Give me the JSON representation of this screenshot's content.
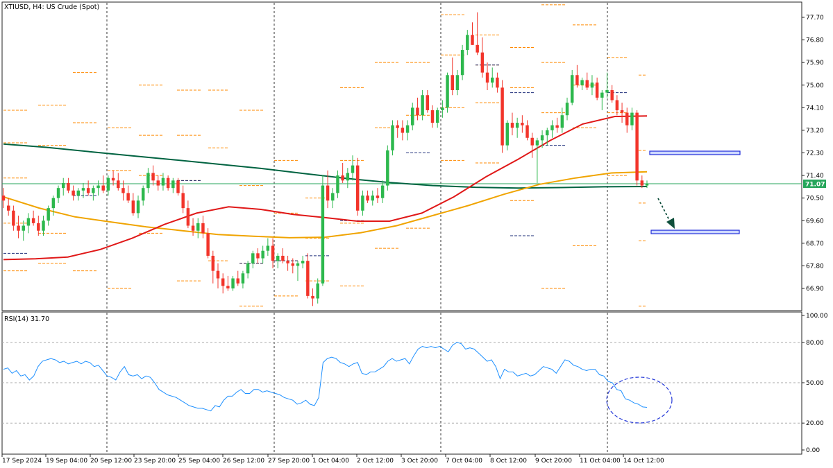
{
  "chart_data": [
    {
      "type": "line",
      "title": "XTIUSD, H4:  US Crude (Spot)",
      "symbol": "XTIUSD",
      "timeframe": "H4",
      "instrument_label": "US Crude (Spot)",
      "price_axis_ticks": [
        "77.70",
        "76.80",
        "75.90",
        "75.00",
        "74.10",
        "73.20",
        "72.30",
        "71.40",
        "70.50",
        "69.60",
        "68.70",
        "67.80",
        "66.90"
      ],
      "ylim": [
        66.2,
        78.2
      ],
      "current_price_label": "71.07",
      "current_price": 71.07,
      "time_axis_labels": [
        "17 Sep 2024",
        "19 Sep 04:00",
        "20 Sep 12:00",
        "23 Sep 20:00",
        "25 Sep 04:00",
        "26 Sep 12:00",
        "27 Sep 20:00",
        "1 Oct 04:00",
        "2 Oct 12:00",
        "3 Oct 20:00",
        "7 Oct 04:00",
        "8 Oct 12:00",
        "9 Oct 20:00",
        "11 Oct 04:00",
        "14 Oct 12:00"
      ],
      "candles_ohlc": [
        [
          70.6,
          70.9,
          70.1,
          70.4
        ],
        [
          70.2,
          70.5,
          69.8,
          70.0
        ],
        [
          70.0,
          70.2,
          69.2,
          69.4
        ],
        [
          69.4,
          69.8,
          68.9,
          69.2
        ],
        [
          69.2,
          69.6,
          68.8,
          69.4
        ],
        [
          69.4,
          69.9,
          69.1,
          69.7
        ],
        [
          69.7,
          70.0,
          69.4,
          69.5
        ],
        [
          69.5,
          69.8,
          69.0,
          69.2
        ],
        [
          69.2,
          69.8,
          69.0,
          69.6
        ],
        [
          69.6,
          70.2,
          69.4,
          70.1
        ],
        [
          70.1,
          70.6,
          69.8,
          70.5
        ],
        [
          70.5,
          71.0,
          70.3,
          70.9
        ],
        [
          70.9,
          71.3,
          70.6,
          71.1
        ],
        [
          71.1,
          71.3,
          70.7,
          70.8
        ],
        [
          70.8,
          71.0,
          70.4,
          70.6
        ],
        [
          70.6,
          70.9,
          70.4,
          70.8
        ],
        [
          70.8,
          71.1,
          70.5,
          70.9
        ],
        [
          70.9,
          71.2,
          70.6,
          70.7
        ],
        [
          70.7,
          71.0,
          70.4,
          70.9
        ],
        [
          70.9,
          71.2,
          70.6,
          71.0
        ],
        [
          71.0,
          71.4,
          70.7,
          70.8
        ],
        [
          70.8,
          71.4,
          70.6,
          71.3
        ],
        [
          71.3,
          71.6,
          71.0,
          71.2
        ],
        [
          71.2,
          71.5,
          70.8,
          70.9
        ],
        [
          70.9,
          71.2,
          70.4,
          70.7
        ],
        [
          70.7,
          71.0,
          70.3,
          70.4
        ],
        [
          70.4,
          70.7,
          69.8,
          69.9
        ],
        [
          69.9,
          70.6,
          69.7,
          70.4
        ],
        [
          70.4,
          71.0,
          70.2,
          70.9
        ],
        [
          70.9,
          71.7,
          70.7,
          71.5
        ],
        [
          71.5,
          71.8,
          71.0,
          71.2
        ],
        [
          71.2,
          71.4,
          70.8,
          71.0
        ],
        [
          71.0,
          71.5,
          70.8,
          71.3
        ],
        [
          71.3,
          71.4,
          70.8,
          70.9
        ],
        [
          70.9,
          71.3,
          70.7,
          71.2
        ],
        [
          71.2,
          71.3,
          70.6,
          70.7
        ],
        [
          70.7,
          71.0,
          69.9,
          70.1
        ],
        [
          70.1,
          70.4,
          69.3,
          69.4
        ],
        [
          69.4,
          69.7,
          69.0,
          69.2
        ],
        [
          69.2,
          69.7,
          68.9,
          69.5
        ],
        [
          69.5,
          69.8,
          68.9,
          69.1
        ],
        [
          69.1,
          69.3,
          68.1,
          68.2
        ],
        [
          68.2,
          68.4,
          67.1,
          67.6
        ],
        [
          67.6,
          67.9,
          66.9,
          67.3
        ],
        [
          67.3,
          67.5,
          66.7,
          67.0
        ],
        [
          67.0,
          67.4,
          66.8,
          66.9
        ],
        [
          66.9,
          67.4,
          66.8,
          67.3
        ],
        [
          67.3,
          67.6,
          67.0,
          67.1
        ],
        [
          67.1,
          67.6,
          66.9,
          67.5
        ],
        [
          67.5,
          68.0,
          67.3,
          67.9
        ],
        [
          67.9,
          68.4,
          67.7,
          68.3
        ],
        [
          68.3,
          68.5,
          67.9,
          68.1
        ],
        [
          68.1,
          68.6,
          67.9,
          68.4
        ],
        [
          68.4,
          68.9,
          68.2,
          68.6
        ],
        [
          68.6,
          68.9,
          67.7,
          68.0
        ],
        [
          68.0,
          68.3,
          67.7,
          68.2
        ],
        [
          68.2,
          68.5,
          67.9,
          68.0
        ],
        [
          68.0,
          68.2,
          67.6,
          67.9
        ],
        [
          67.9,
          68.1,
          67.5,
          67.8
        ],
        [
          67.8,
          68.0,
          67.2,
          67.9
        ],
        [
          67.9,
          68.2,
          67.7,
          68.0
        ],
        [
          68.0,
          68.3,
          66.5,
          66.6
        ],
        [
          66.6,
          66.9,
          66.2,
          66.5
        ],
        [
          66.5,
          67.3,
          66.3,
          67.1
        ],
        [
          67.1,
          71.4,
          67.0,
          71.0
        ],
        [
          71.0,
          71.6,
          70.1,
          70.4
        ],
        [
          70.4,
          70.9,
          70.1,
          70.7
        ],
        [
          70.7,
          71.6,
          70.5,
          71.4
        ],
        [
          71.4,
          71.9,
          71.1,
          71.2
        ],
        [
          71.2,
          71.7,
          70.9,
          71.5
        ],
        [
          71.5,
          72.2,
          71.2,
          71.8
        ],
        [
          71.8,
          72.1,
          69.8,
          70.0
        ],
        [
          70.0,
          70.8,
          69.8,
          70.6
        ],
        [
          70.6,
          70.8,
          70.3,
          70.4
        ],
        [
          70.4,
          70.8,
          70.2,
          70.6
        ],
        [
          70.6,
          70.9,
          70.3,
          70.5
        ],
        [
          70.5,
          71.2,
          70.3,
          71.0
        ],
        [
          71.0,
          72.6,
          70.8,
          72.4
        ],
        [
          72.4,
          73.6,
          72.2,
          73.4
        ],
        [
          73.4,
          73.6,
          72.9,
          73.3
        ],
        [
          73.3,
          73.6,
          72.8,
          73.1
        ],
        [
          73.1,
          73.6,
          72.8,
          73.4
        ],
        [
          73.4,
          74.3,
          73.2,
          74.1
        ],
        [
          74.1,
          74.5,
          73.6,
          73.8
        ],
        [
          73.8,
          74.8,
          73.6,
          74.6
        ],
        [
          74.6,
          74.8,
          73.9,
          74.0
        ],
        [
          74.0,
          74.2,
          73.3,
          73.5
        ],
        [
          73.5,
          74.1,
          73.3,
          74.0
        ],
        [
          74.0,
          74.4,
          73.7,
          74.1
        ],
        [
          74.1,
          75.5,
          73.9,
          75.4
        ],
        [
          75.4,
          76.1,
          74.6,
          74.8
        ],
        [
          74.8,
          75.6,
          74.6,
          75.4
        ],
        [
          75.4,
          76.6,
          75.2,
          76.4
        ],
        [
          76.4,
          77.2,
          76.2,
          77.0
        ],
        [
          77.0,
          77.5,
          76.6,
          76.6
        ],
        [
          76.6,
          77.9,
          76.2,
          76.3
        ],
        [
          76.3,
          76.9,
          75.3,
          75.5
        ],
        [
          75.5,
          75.9,
          74.8,
          75.1
        ],
        [
          75.1,
          75.7,
          74.9,
          75.3
        ],
        [
          75.3,
          75.5,
          74.7,
          74.9
        ],
        [
          74.9,
          75.2,
          72.3,
          72.6
        ],
        [
          72.6,
          73.6,
          72.4,
          73.5
        ],
        [
          73.5,
          73.9,
          73.0,
          73.3
        ],
        [
          73.3,
          73.7,
          72.9,
          73.5
        ],
        [
          73.5,
          73.8,
          73.1,
          73.4
        ],
        [
          73.4,
          73.6,
          72.8,
          72.9
        ],
        [
          72.9,
          73.1,
          72.1,
          72.6
        ],
        [
          72.6,
          72.9,
          71.1,
          72.8
        ],
        [
          72.8,
          73.2,
          72.5,
          73.0
        ],
        [
          73.0,
          73.3,
          72.6,
          73.2
        ],
        [
          73.2,
          73.6,
          72.9,
          73.4
        ],
        [
          73.4,
          73.7,
          73.1,
          73.3
        ],
        [
          73.3,
          74.1,
          73.1,
          73.8
        ],
        [
          73.8,
          74.5,
          73.6,
          74.3
        ],
        [
          74.3,
          75.6,
          74.2,
          75.4
        ],
        [
          75.4,
          75.8,
          74.9,
          75.0
        ],
        [
          75.0,
          75.3,
          74.8,
          75.2
        ],
        [
          75.2,
          75.5,
          74.8,
          74.9
        ],
        [
          74.9,
          75.4,
          74.6,
          75.1
        ],
        [
          75.1,
          75.3,
          74.4,
          74.5
        ],
        [
          74.5,
          74.8,
          74.0,
          74.7
        ],
        [
          74.7,
          75.5,
          74.5,
          74.8
        ],
        [
          74.8,
          75.0,
          74.3,
          74.4
        ],
        [
          74.4,
          74.6,
          73.8,
          74.0
        ],
        [
          74.0,
          74.3,
          73.5,
          73.9
        ],
        [
          73.9,
          74.1,
          73.1,
          73.4
        ],
        [
          73.4,
          74.1,
          73.2,
          73.9
        ],
        [
          73.9,
          74.0,
          71.0,
          71.2
        ],
        [
          71.2,
          71.4,
          70.9,
          71.0
        ],
        [
          71.0,
          71.2,
          70.9,
          71.07
        ]
      ],
      "series": [
        {
          "name": "",
          "color": "#006341",
          "values": [
            72.65,
            72.52,
            72.35,
            72.18,
            72.02,
            71.85,
            71.68,
            71.48,
            71.28,
            71.12,
            71.0,
            70.93,
            70.9,
            70.92,
            70.95,
            70.96
          ]
        },
        {
          "name": "",
          "color": "#F0A400",
          "values": [
            70.55,
            70.1,
            69.75,
            69.55,
            69.35,
            69.2,
            69.05,
            68.98,
            68.92,
            68.94,
            69.12,
            69.4,
            69.8,
            70.2,
            70.65,
            71.05,
            71.3,
            71.5,
            71.55
          ]
        },
        {
          "name": "",
          "color": "#E01818",
          "values": [
            68.05,
            68.08,
            68.15,
            68.45,
            68.9,
            69.45,
            69.9,
            70.15,
            70.05,
            69.85,
            69.72,
            69.58,
            69.58,
            69.9,
            70.55,
            71.35,
            72.05,
            72.8,
            73.45,
            73.75,
            73.77
          ]
        }
      ],
      "pivot_levels_note": "dashed horizontal daily reference levels (orange/navy)",
      "zones": [
        {
          "name": "upper-zone",
          "price": 72.3
        },
        {
          "name": "lower-zone",
          "price": 69.15
        }
      ]
    },
    {
      "type": "line",
      "title": "RSI(14) 31.70",
      "indicator": "RSI(14)",
      "value_label": "31.70",
      "value": 31.7,
      "y_axis_ticks": [
        "100.00",
        "80.00",
        "50.00",
        "20.00",
        "0.00"
      ],
      "ylim": [
        0,
        100
      ],
      "levels": [
        80,
        50,
        20
      ],
      "color": "#1e90ff",
      "values": [
        60,
        61,
        57,
        59,
        55,
        56,
        52,
        55,
        62,
        66,
        67,
        68,
        67,
        65,
        66,
        64,
        65,
        66,
        64,
        66,
        65,
        62,
        63,
        59,
        55,
        54,
        52,
        58,
        62,
        56,
        55,
        56,
        53,
        55,
        54,
        50,
        45,
        43,
        41,
        40,
        39,
        37,
        35,
        33,
        32,
        31,
        31,
        30,
        29,
        33,
        32,
        37,
        40,
        40,
        43,
        45,
        42,
        42,
        45,
        45,
        43,
        44,
        43,
        42,
        41,
        39,
        38,
        37,
        34,
        35,
        37,
        34,
        33,
        39,
        65,
        68,
        69,
        68,
        65,
        64,
        62,
        64,
        65,
        57,
        56,
        58,
        58,
        60,
        62,
        66,
        68,
        66,
        67,
        68,
        64,
        70,
        75,
        77,
        76,
        77,
        76,
        77,
        75,
        73,
        78,
        80,
        79,
        75,
        76,
        75,
        72,
        69,
        66,
        67,
        62,
        53,
        60,
        58,
        58,
        55,
        56,
        57,
        55,
        56,
        59,
        62,
        61,
        60,
        57,
        62,
        67,
        66,
        63,
        62,
        60,
        59,
        60,
        60,
        56,
        55,
        51,
        50,
        45,
        44,
        38,
        37,
        35,
        34,
        32,
        31.7
      ]
    }
  ]
}
